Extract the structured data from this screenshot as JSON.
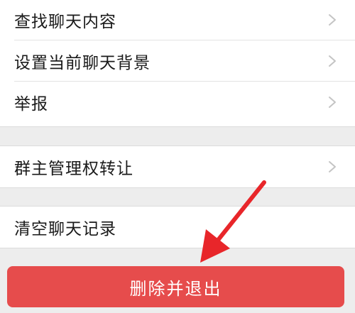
{
  "settings": {
    "group1": [
      {
        "label": "查找聊天内容",
        "chevron": true
      },
      {
        "label": "设置当前聊天背景",
        "chevron": true
      },
      {
        "label": "举报",
        "chevron": true
      }
    ],
    "group2": [
      {
        "label": "群主管理权转让",
        "chevron": true
      }
    ],
    "group3": [
      {
        "label": "清空聊天记录",
        "chevron": false
      }
    ]
  },
  "action": {
    "label": "删除并退出",
    "color": "#e64c4c"
  },
  "annotation": {
    "icon": "red-arrow-icon",
    "color": "#e8262a"
  }
}
